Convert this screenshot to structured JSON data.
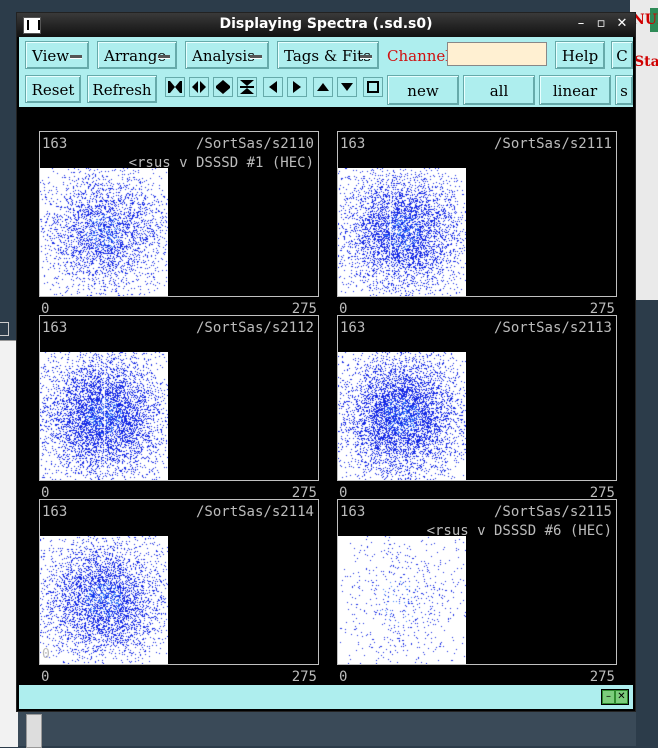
{
  "window": {
    "title": "Displaying Spectra (.sd.s0)"
  },
  "menubar": {
    "menus": [
      "View",
      "Arrange",
      "Analysis",
      "Tags & Fits"
    ],
    "channel_label": "Channel:",
    "channel_value": "",
    "help_label": "Help",
    "c_label": "C",
    "reset_label": "Reset",
    "refresh_label": "Refresh",
    "new_label": "new",
    "all_label": "all",
    "linear_label": "linear",
    "s_label": "s"
  },
  "background": {
    "right_window_text": "NUI",
    "right_window_text2": "Sta"
  },
  "spectra": [
    {
      "count": "163",
      "name": "/SortSas/s2110",
      "subtitle": "<rsus v DSSSD #1 (HEC)",
      "xmin": "0",
      "xmax": "275",
      "density": 0.35
    },
    {
      "count": "163",
      "name": "/SortSas/s2111",
      "subtitle": "",
      "xmin": "0",
      "xmax": "275",
      "density": 0.5
    },
    {
      "count": "163",
      "name": "/SortSas/s2112",
      "subtitle": "",
      "xmin": "0",
      "xmax": "275",
      "density": 0.6
    },
    {
      "count": "163",
      "name": "/SortSas/s2113",
      "subtitle": "",
      "xmin": "0",
      "xmax": "275",
      "density": 0.6
    },
    {
      "count": "163",
      "name": "/SortSas/s2114",
      "subtitle": "",
      "xmin": "0",
      "xmax": "275",
      "density": 0.45,
      "zero_label": "0"
    },
    {
      "count": "163",
      "name": "/SortSas/s2115",
      "subtitle": "<rsus v DSSSD #6 (HEC)",
      "xmin": "0",
      "xmax": "275",
      "density": 0.08
    }
  ],
  "colors": {
    "panel_bg": "#aeeeee",
    "channel_label": "#d01010",
    "channel_input_bg": "#fff0d2",
    "spectrum_point": "#1428e6",
    "spectrum_core": "#3c82ff"
  }
}
